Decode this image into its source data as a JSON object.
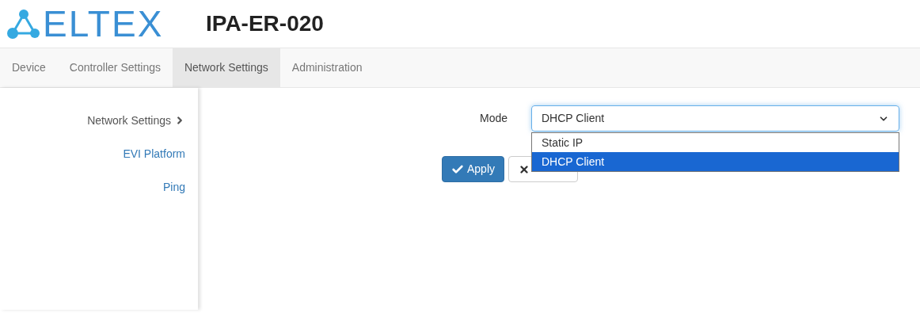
{
  "header": {
    "logo_text": "ELTEX",
    "title": "IPA-ER-020"
  },
  "tabs": [
    {
      "label": "Device",
      "selected": false
    },
    {
      "label": "Controller Settings",
      "selected": false
    },
    {
      "label": "Network Settings",
      "selected": true
    },
    {
      "label": "Administration",
      "selected": false
    }
  ],
  "sidebar": {
    "items": [
      {
        "label": "Network Settings",
        "selected": true
      },
      {
        "label": "EVI Platform",
        "selected": false
      },
      {
        "label": "Ping",
        "selected": false
      }
    ]
  },
  "form": {
    "label": "Mode",
    "value": "DHCP Client",
    "expanded": true,
    "options": [
      {
        "label": "Static IP",
        "selected": false
      },
      {
        "label": "DHCP Client",
        "selected": true
      }
    ]
  },
  "buttons": [
    {
      "kind": "apply",
      "label": "Apply"
    },
    {
      "kind": "cancel"
    }
  ]
}
